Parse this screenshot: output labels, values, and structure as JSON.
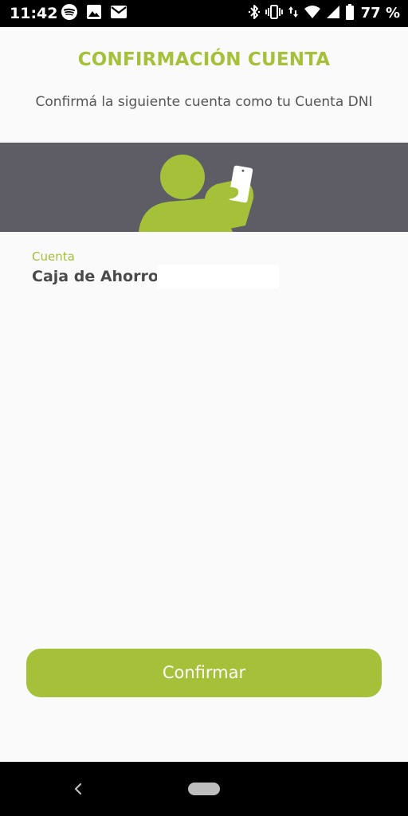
{
  "status_bar": {
    "time": "11:42",
    "battery_text": "77 %",
    "left_icons": [
      "spotify-icon",
      "image-icon",
      "mail-icon"
    ],
    "right_icons": [
      "bluetooth-icon",
      "vibrate-icon",
      "data-arrows-icon",
      "wifi-icon",
      "signal-icon",
      "battery-icon"
    ]
  },
  "header": {
    "title": "CONFIRMACIÓN CUENTA",
    "subtitle": "Confirmá la siguiente cuenta como tu Cuenta DNI"
  },
  "banner": {
    "illustration": "person-with-phone-illustration"
  },
  "account": {
    "label": "Cuenta",
    "value": "Caja de Ahorro"
  },
  "actions": {
    "confirm_label": "Confirmar"
  },
  "nav_bar": {
    "back_icon": "chevron-left-icon",
    "home_icon": "home-pill-icon"
  },
  "colors": {
    "accent": "#a4c139",
    "banner_bg": "#5e5d66",
    "text_dark": "#4a4a4a",
    "background": "#fafafa"
  }
}
